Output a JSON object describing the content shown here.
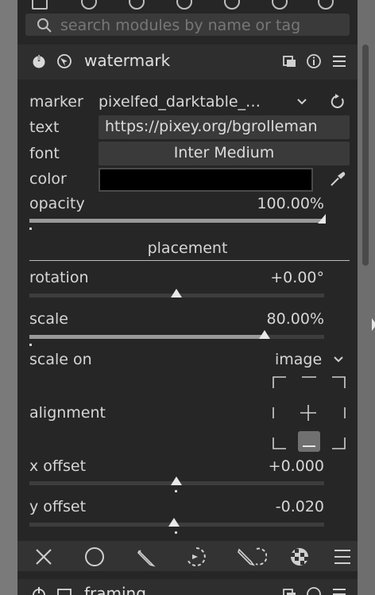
{
  "search": {
    "placeholder": "search modules by name or tag"
  },
  "module": {
    "title": "watermark",
    "marker": {
      "label": "marker",
      "value": "pixelfed_darktable_…"
    },
    "text": {
      "label": "text",
      "value": "https://pixey.org/bgrolleman"
    },
    "font": {
      "label": "font",
      "value": "Inter Medium"
    },
    "color": {
      "label": "color",
      "value": "#000000"
    },
    "opacity": {
      "label": "opacity",
      "value": "100.00%",
      "fraction": 1.0
    },
    "placement_section": "placement",
    "rotation": {
      "label": "rotation",
      "value": "+0.00°"
    },
    "scale": {
      "label": "scale",
      "value": "80.00%",
      "fraction": 0.8
    },
    "scale_on": {
      "label": "scale on",
      "value": "image"
    },
    "alignment": {
      "label": "alignment",
      "selected": "bottom-center"
    },
    "x_offset": {
      "label": "x offset",
      "value": "+0.000"
    },
    "y_offset": {
      "label": "y offset",
      "value": "-0.020"
    }
  },
  "footer_icons": [
    "close-icon",
    "circle-mask-icon",
    "pencil-icon",
    "parametric-mask-icon",
    "drawn-parametric-mask-icon",
    "raster-mask-icon",
    "blend-menu-icon"
  ],
  "next_module": {
    "title": "framing"
  }
}
